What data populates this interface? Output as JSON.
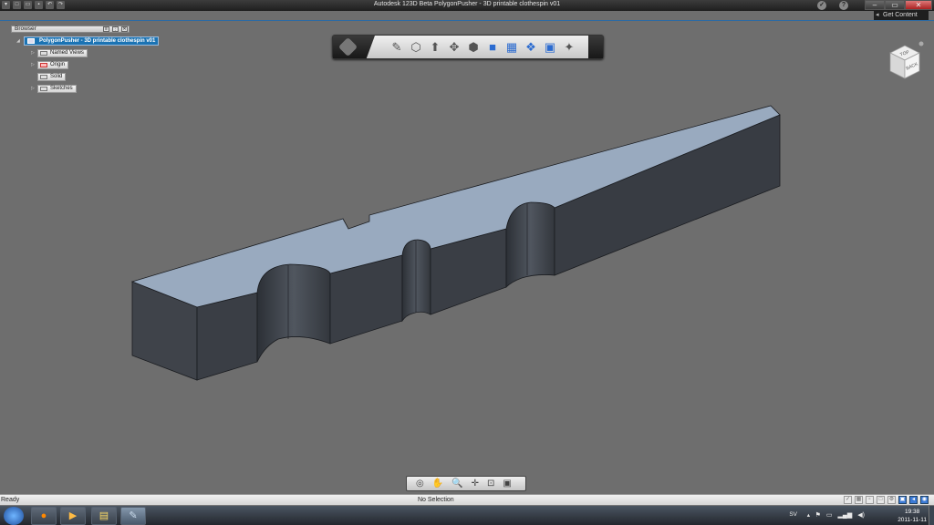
{
  "window": {
    "title": "Autodesk 123D Beta    PolygonPusher - 3D printable clothespin v01",
    "minimize": "–",
    "maximize": "▭",
    "close": "✕",
    "get_content": "Get Content",
    "help_icon": "?"
  },
  "browser": {
    "title": "Browser",
    "root": "PolygonPusher - 3D printable clothespin v01",
    "items": [
      {
        "label": "Named Views",
        "icon": "folder-icon"
      },
      {
        "label": "Origin",
        "icon": "origin-icon"
      },
      {
        "label": "Solid",
        "icon": "solid-icon"
      },
      {
        "label": "Sketches",
        "icon": "folder-icon"
      }
    ]
  },
  "viewcube": {
    "top_face": "TOP",
    "side_face": "BACK"
  },
  "statusbar": {
    "left": "Ready",
    "center": "No Selection"
  },
  "taskbar": {
    "language": "SV",
    "time": "19:38",
    "date": "2011-11-11"
  },
  "colors": {
    "viewport_bg": "#6e6e6e",
    "model_top": "#99aabf",
    "model_side": "#3a3e45",
    "accent": "#1b73b3"
  }
}
